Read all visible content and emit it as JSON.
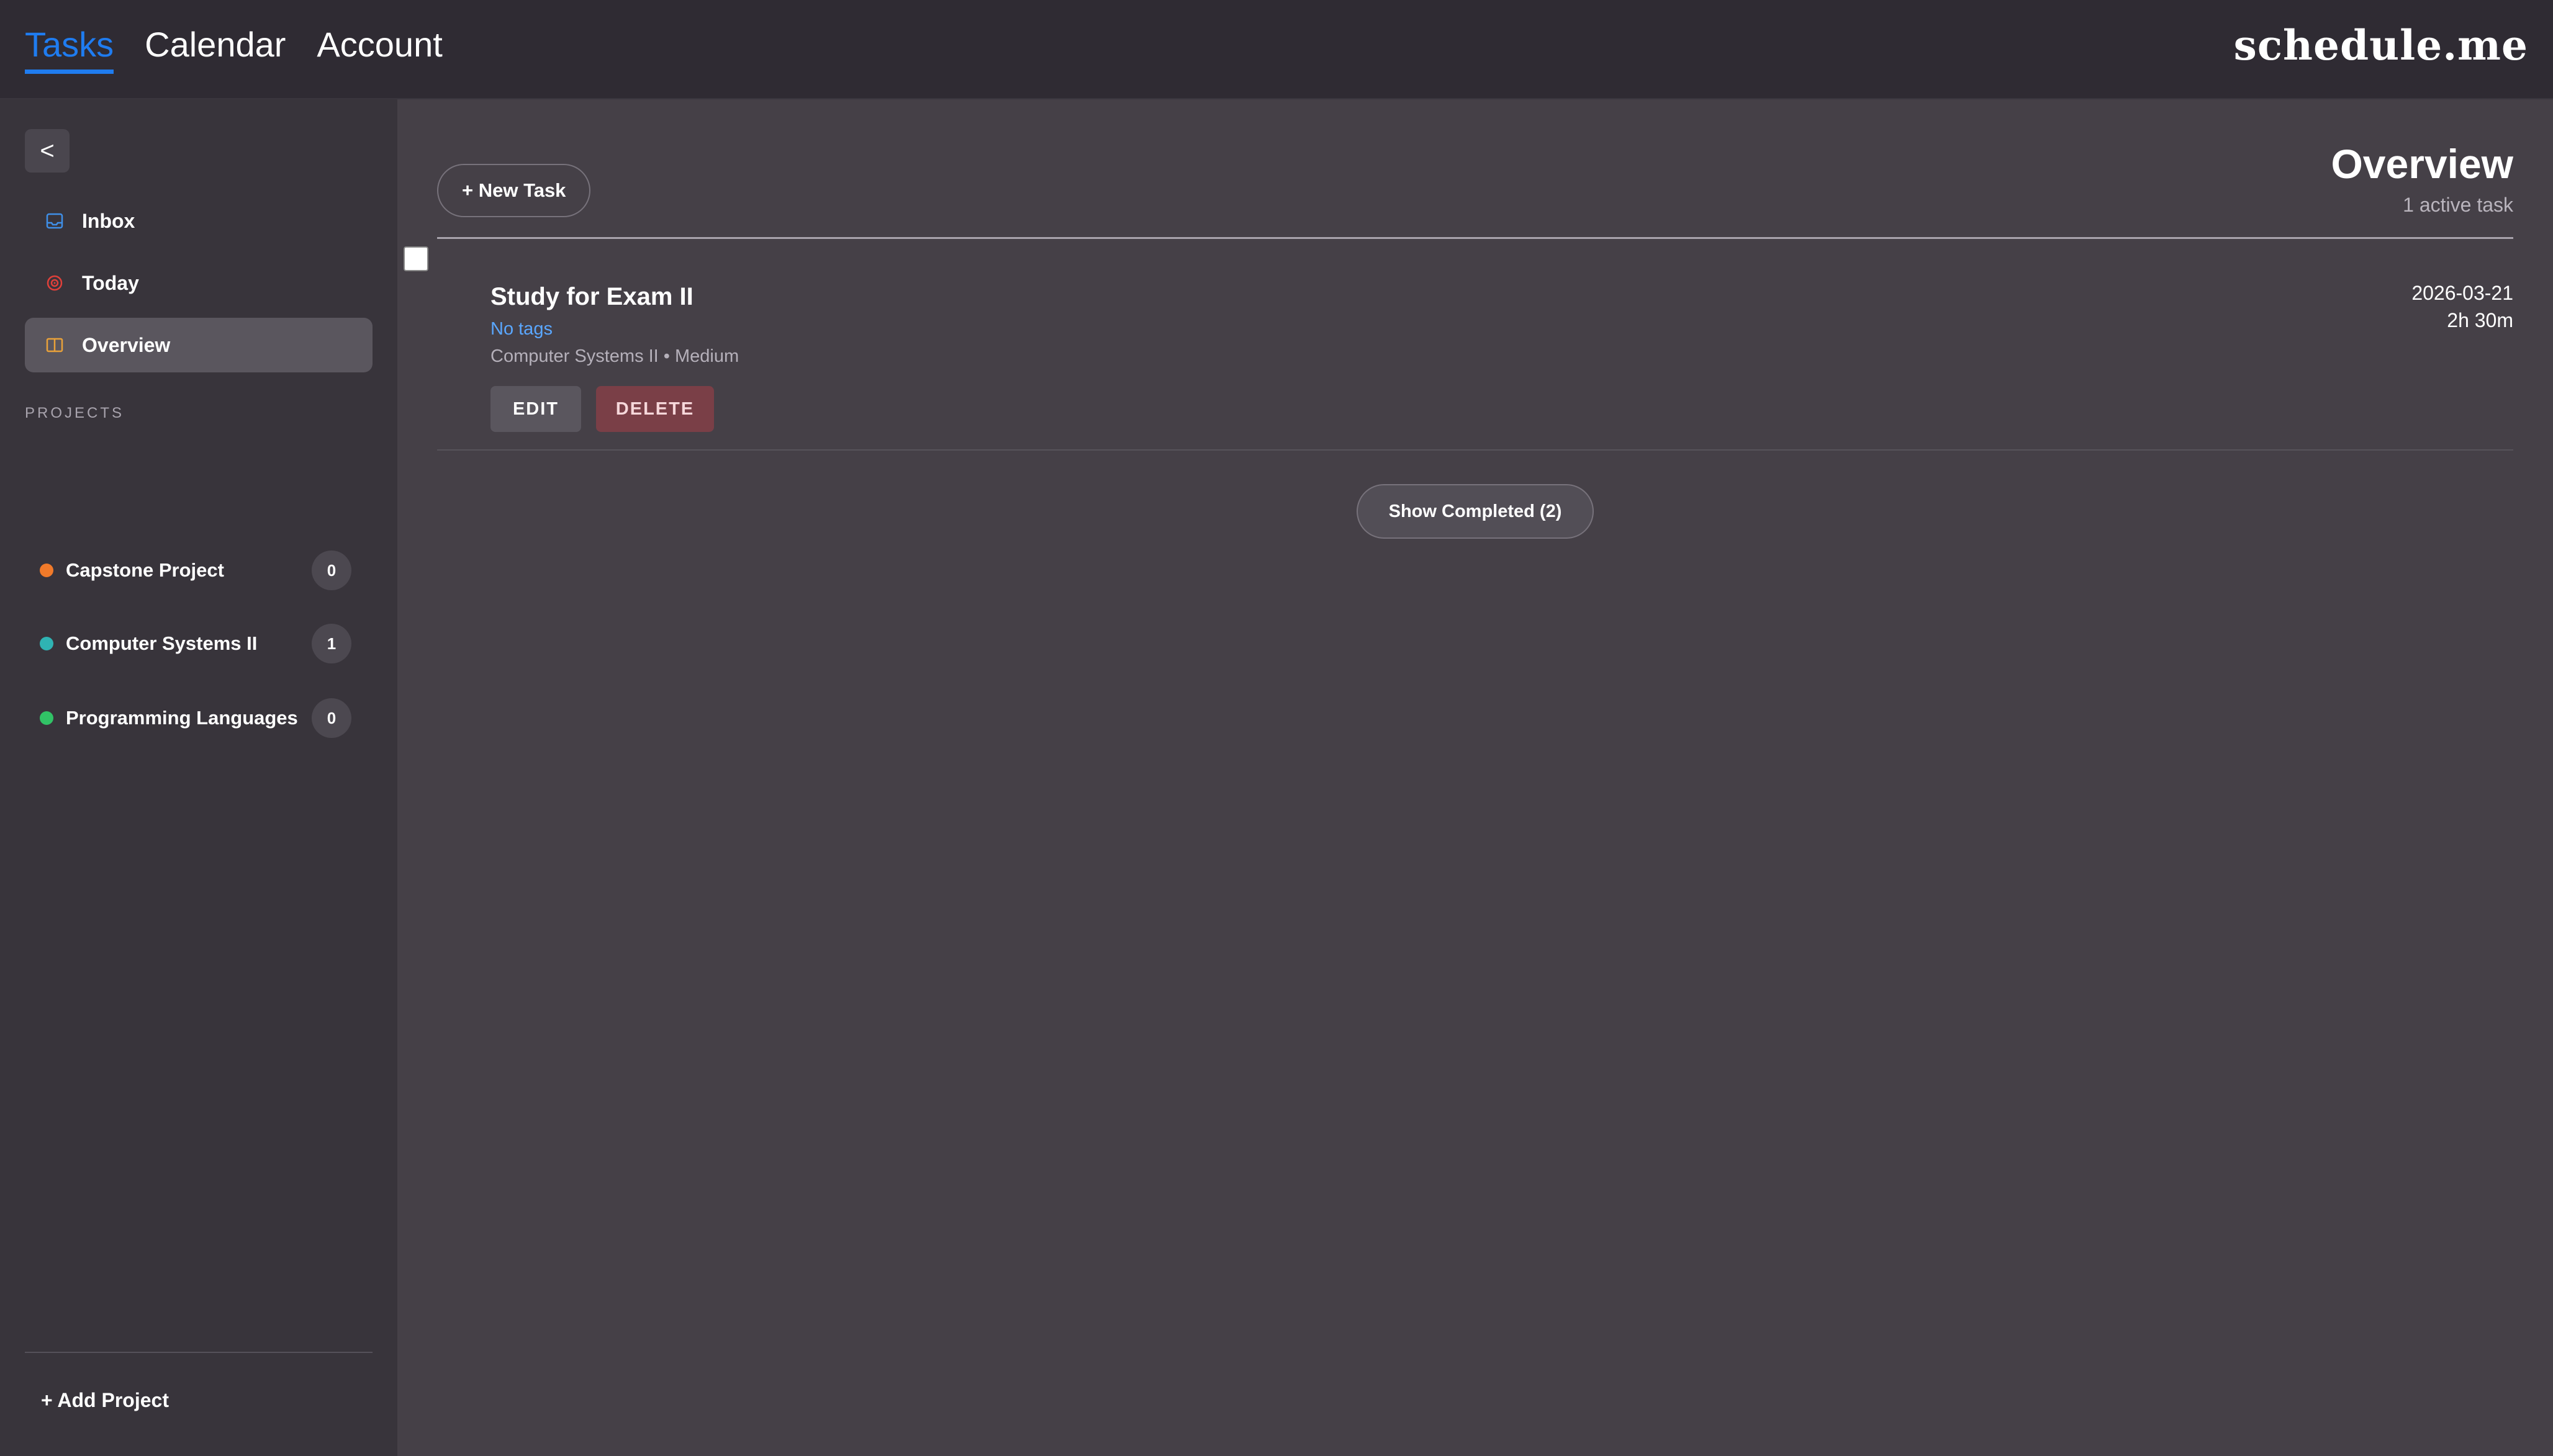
{
  "topbar": {
    "tabs": [
      {
        "label": "Tasks",
        "active": true
      },
      {
        "label": "Calendar",
        "active": false
      },
      {
        "label": "Account",
        "active": false
      }
    ],
    "brand": "schedule.me"
  },
  "sidebar": {
    "collapse_label": "<",
    "links": [
      {
        "label": "Inbox",
        "icon": "inbox-icon",
        "active": false
      },
      {
        "label": "Today",
        "icon": "target-icon",
        "active": false
      },
      {
        "label": "Overview",
        "icon": "book-icon",
        "active": true
      }
    ],
    "projects_heading": "PROJECTS",
    "projects": [
      {
        "name": "Capstone Project",
        "count": "0",
        "color": "#f07a2a"
      },
      {
        "name": "Computer Systems II",
        "count": "1",
        "color": "#2fb3b3"
      },
      {
        "name": "Programming Languages",
        "count": "0",
        "color": "#31c266"
      }
    ],
    "add_project_label": "+ Add Project"
  },
  "main": {
    "new_task_label": "+ New Task",
    "title": "Overview",
    "subtitle": "1 active task",
    "tasks": [
      {
        "title": "Study for Exam II",
        "tags": "No tags",
        "meta": "Computer Systems II • Medium",
        "date": "2026-03-21",
        "duration": "2h 30m",
        "edit_label": "EDIT",
        "delete_label": "DELETE",
        "completed": false
      }
    ],
    "show_completed_label": "Show Completed (2)"
  },
  "colors": {
    "accent": "#1f7cf0",
    "tag_link": "#5aa7ff",
    "delete": "#7a3f47",
    "inbox_icon": "#3f8fe8",
    "today_icon": "#e0403a",
    "overview_icon": "#e8a13a"
  }
}
